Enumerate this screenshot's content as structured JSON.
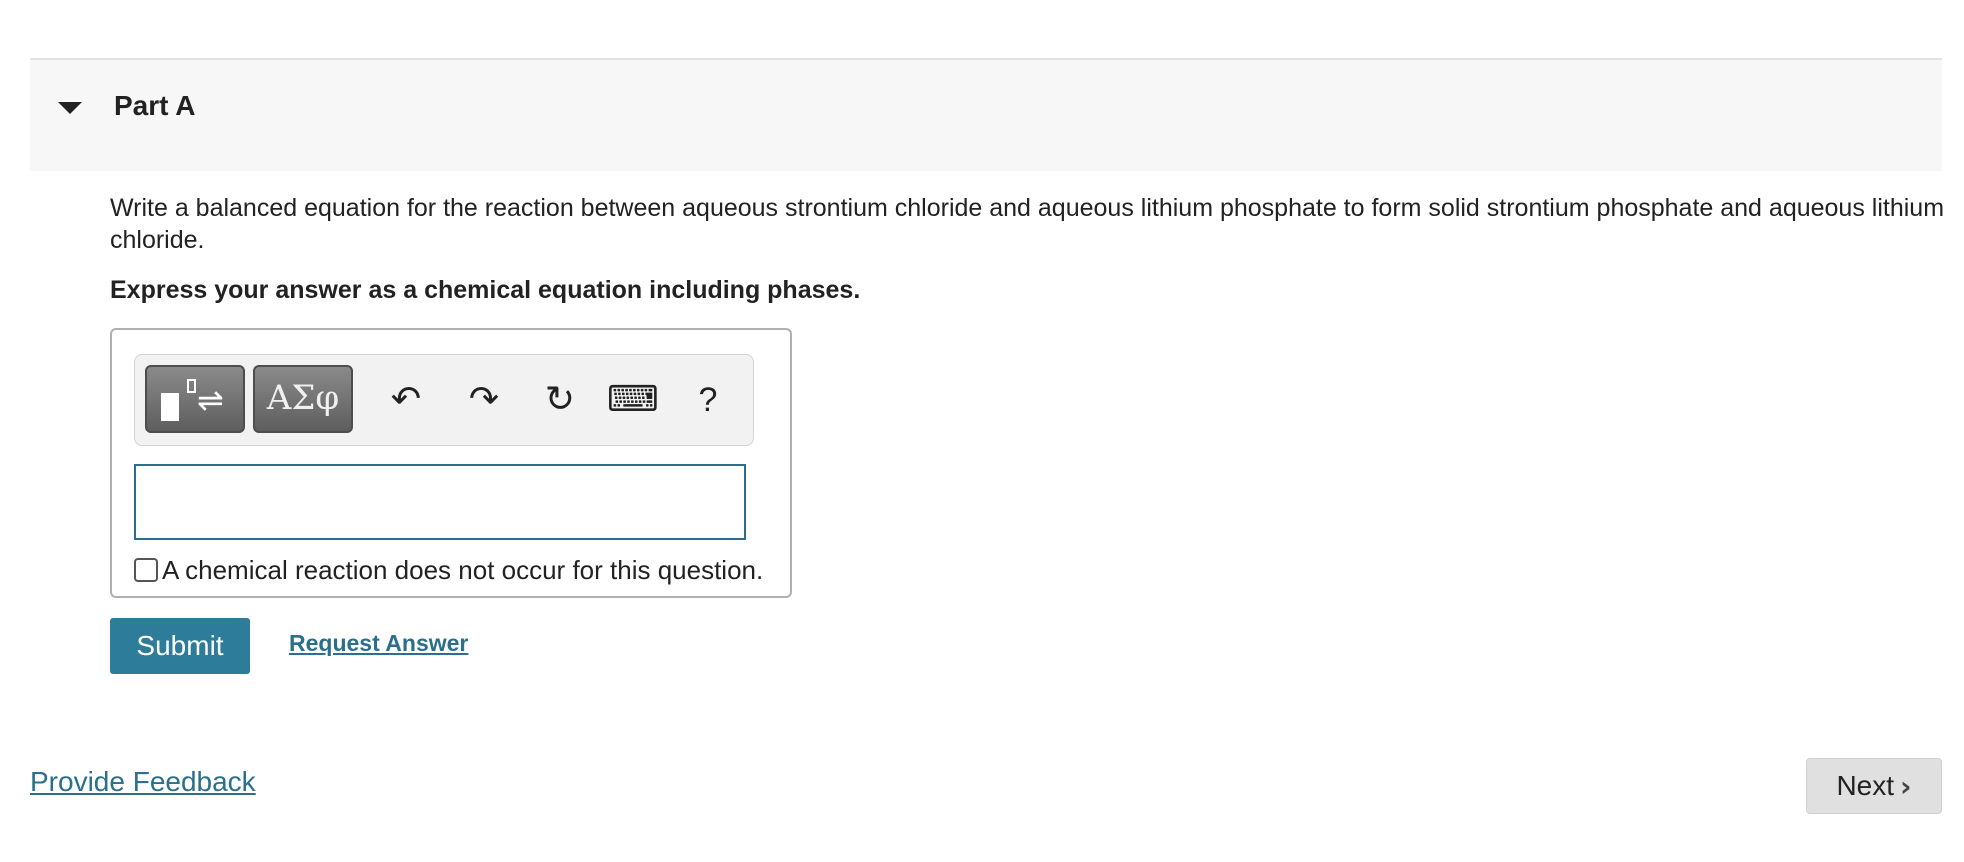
{
  "part": {
    "title": "Part A"
  },
  "question": {
    "text": "Write a balanced equation for the reaction between aqueous strontium chloride and aqueous lithium phosphate to form solid strontium phosphate and aqueous lithium chloride.",
    "instruction": "Express your answer as a chemical equation including phases."
  },
  "toolbar": {
    "templates_icon": "templates-icon",
    "symbols_label": "ΑΣφ",
    "undo_glyph": "↶",
    "redo_glyph": "↷",
    "reset_glyph": "↻",
    "keyboard_glyph": "⌨",
    "help_label": "?"
  },
  "answer": {
    "value": "",
    "no_reaction_label": "A chemical reaction does not occur for this question.",
    "no_reaction_checked": false
  },
  "actions": {
    "submit_label": "Submit",
    "request_answer_label": "Request Answer"
  },
  "footer": {
    "feedback_label": "Provide Feedback",
    "next_label": "Next",
    "next_chevron": "›"
  },
  "colors": {
    "accent": "#2d7c9a",
    "link": "#2a6f8c",
    "header_bg": "#f7f7f7"
  }
}
